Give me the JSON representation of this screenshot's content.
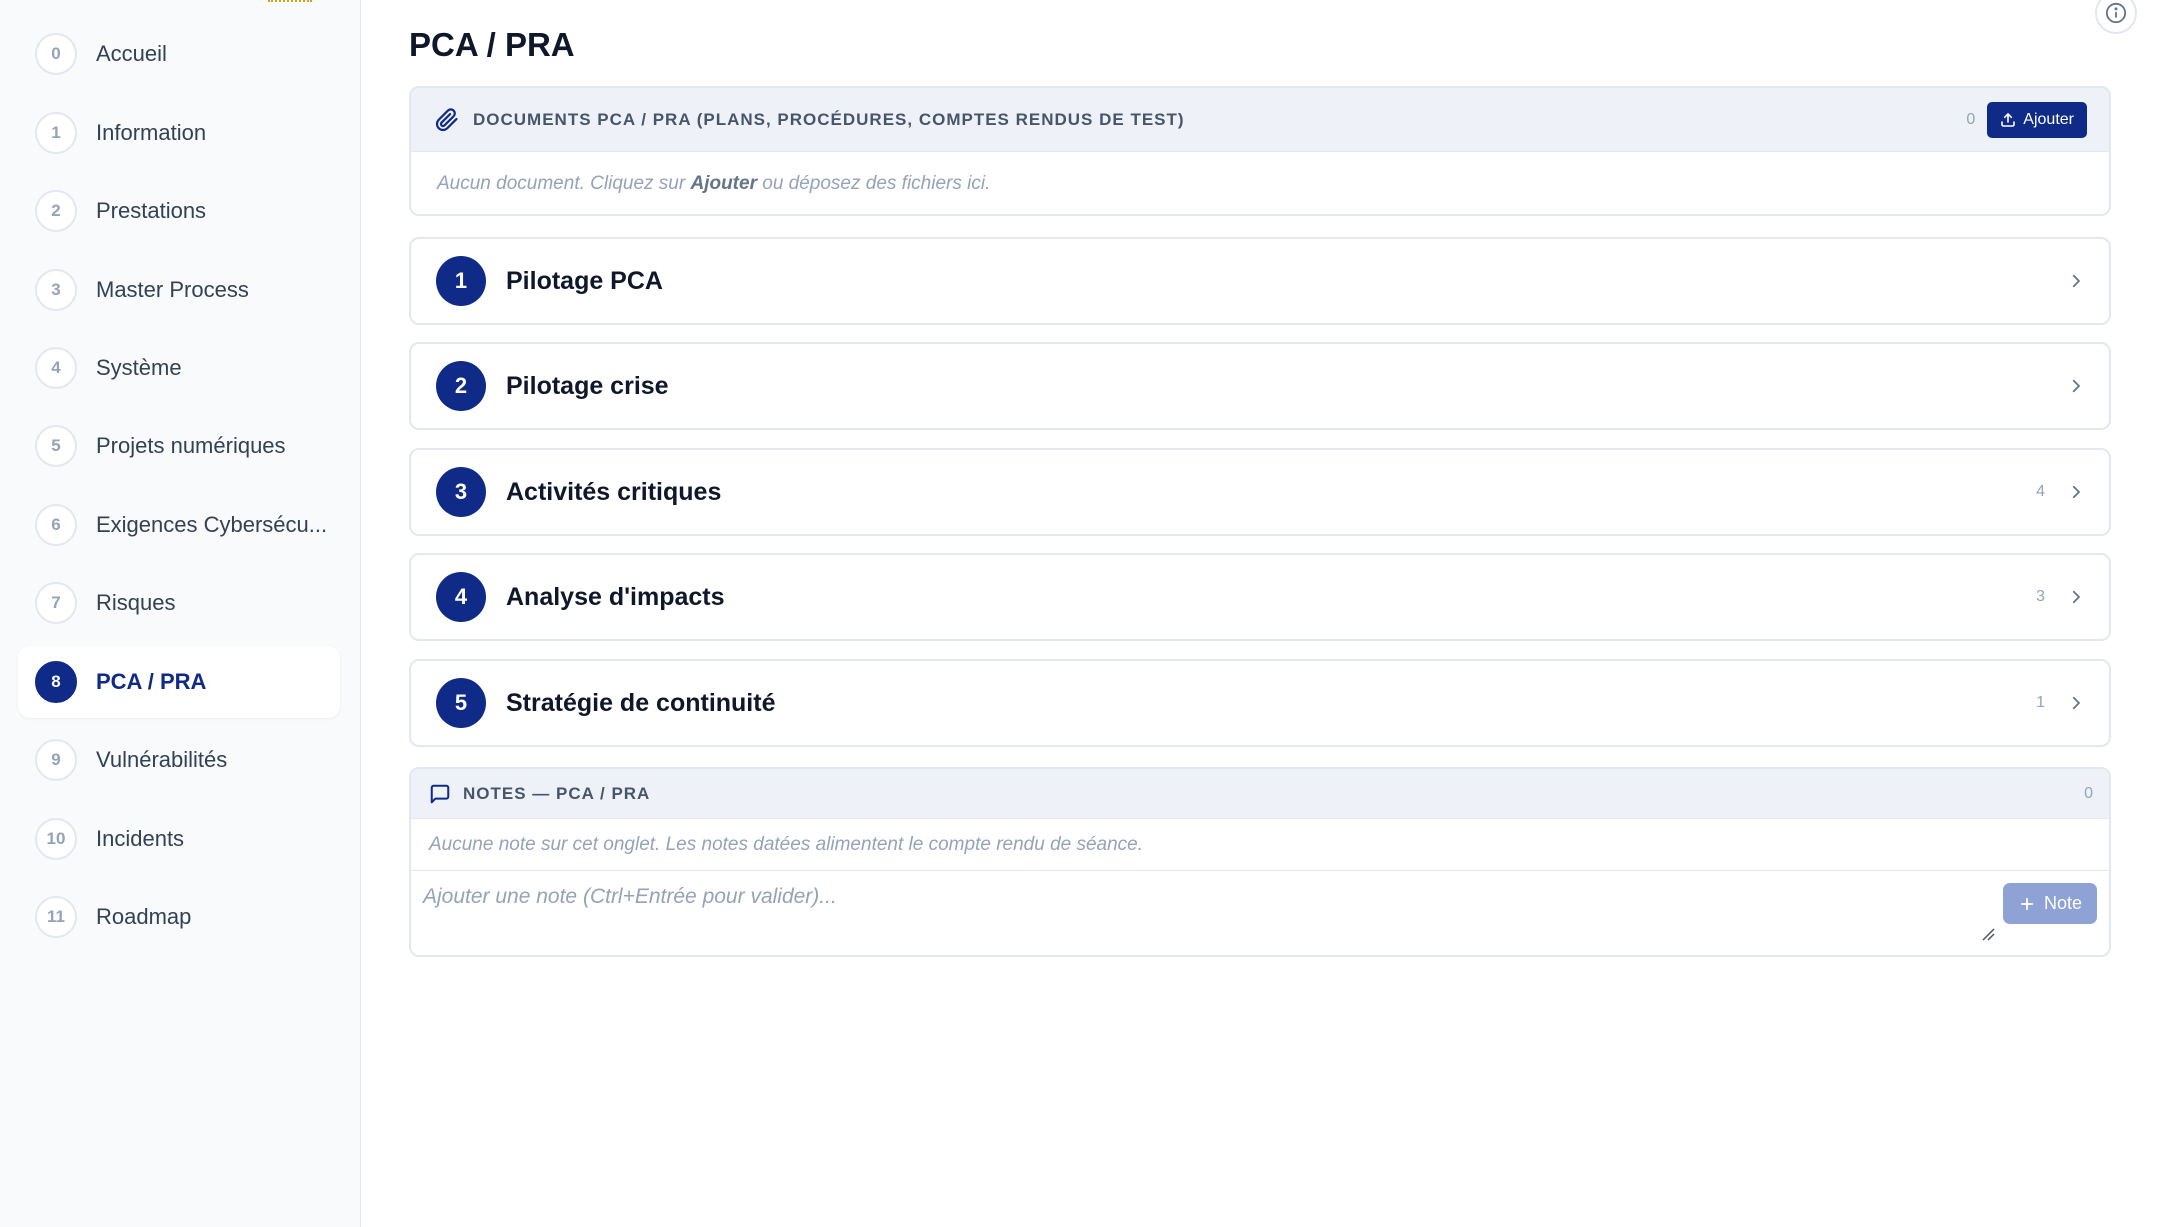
{
  "sidebar": {
    "items": [
      {
        "num": "0",
        "label": "Accueil"
      },
      {
        "num": "1",
        "label": "Information"
      },
      {
        "num": "2",
        "label": "Prestations"
      },
      {
        "num": "3",
        "label": "Master Process"
      },
      {
        "num": "4",
        "label": "Système"
      },
      {
        "num": "5",
        "label": "Projets numériques"
      },
      {
        "num": "6",
        "label": "Exigences Cybersécu..."
      },
      {
        "num": "7",
        "label": "Risques"
      },
      {
        "num": "8",
        "label": "PCA / PRA"
      },
      {
        "num": "9",
        "label": "Vulnérabilités"
      },
      {
        "num": "10",
        "label": "Incidents"
      },
      {
        "num": "11",
        "label": "Roadmap"
      }
    ],
    "active_index": 8
  },
  "main": {
    "title": "PCA / PRA",
    "documents": {
      "title": "DOCUMENTS PCA / PRA (PLANS, PROCÉDURES, COMPTES RENDUS DE TEST)",
      "count": "0",
      "add_label": "Ajouter",
      "empty_before": "Aucun document. Cliquez sur ",
      "empty_bold": "Ajouter",
      "empty_after": " ou déposez des fichiers ici."
    },
    "sections": [
      {
        "num": "1",
        "title": "Pilotage PCA",
        "count": ""
      },
      {
        "num": "2",
        "title": "Pilotage crise",
        "count": ""
      },
      {
        "num": "3",
        "title": "Activités critiques",
        "count": "4"
      },
      {
        "num": "4",
        "title": "Analyse d'impacts",
        "count": "3"
      },
      {
        "num": "5",
        "title": "Stratégie de continuité",
        "count": "1"
      }
    ],
    "notes": {
      "title": "NOTES — PCA / PRA",
      "count": "0",
      "empty": "Aucune note sur cet onglet. Les notes datées alimentent le compte rendu de séance.",
      "placeholder": "Ajouter une note (Ctrl+Entrée pour valider)...",
      "button_label": "Note"
    }
  },
  "colors": {
    "accent": "#0f2a87",
    "panel_header": "#eef2f8",
    "muted_text": "#94a3b8"
  },
  "icons": {
    "documents": "paperclip-icon",
    "upload": "upload-icon",
    "notes": "message-square-icon",
    "chevron": "chevron-right-icon",
    "info": "info-icon",
    "add": "plus-icon"
  }
}
